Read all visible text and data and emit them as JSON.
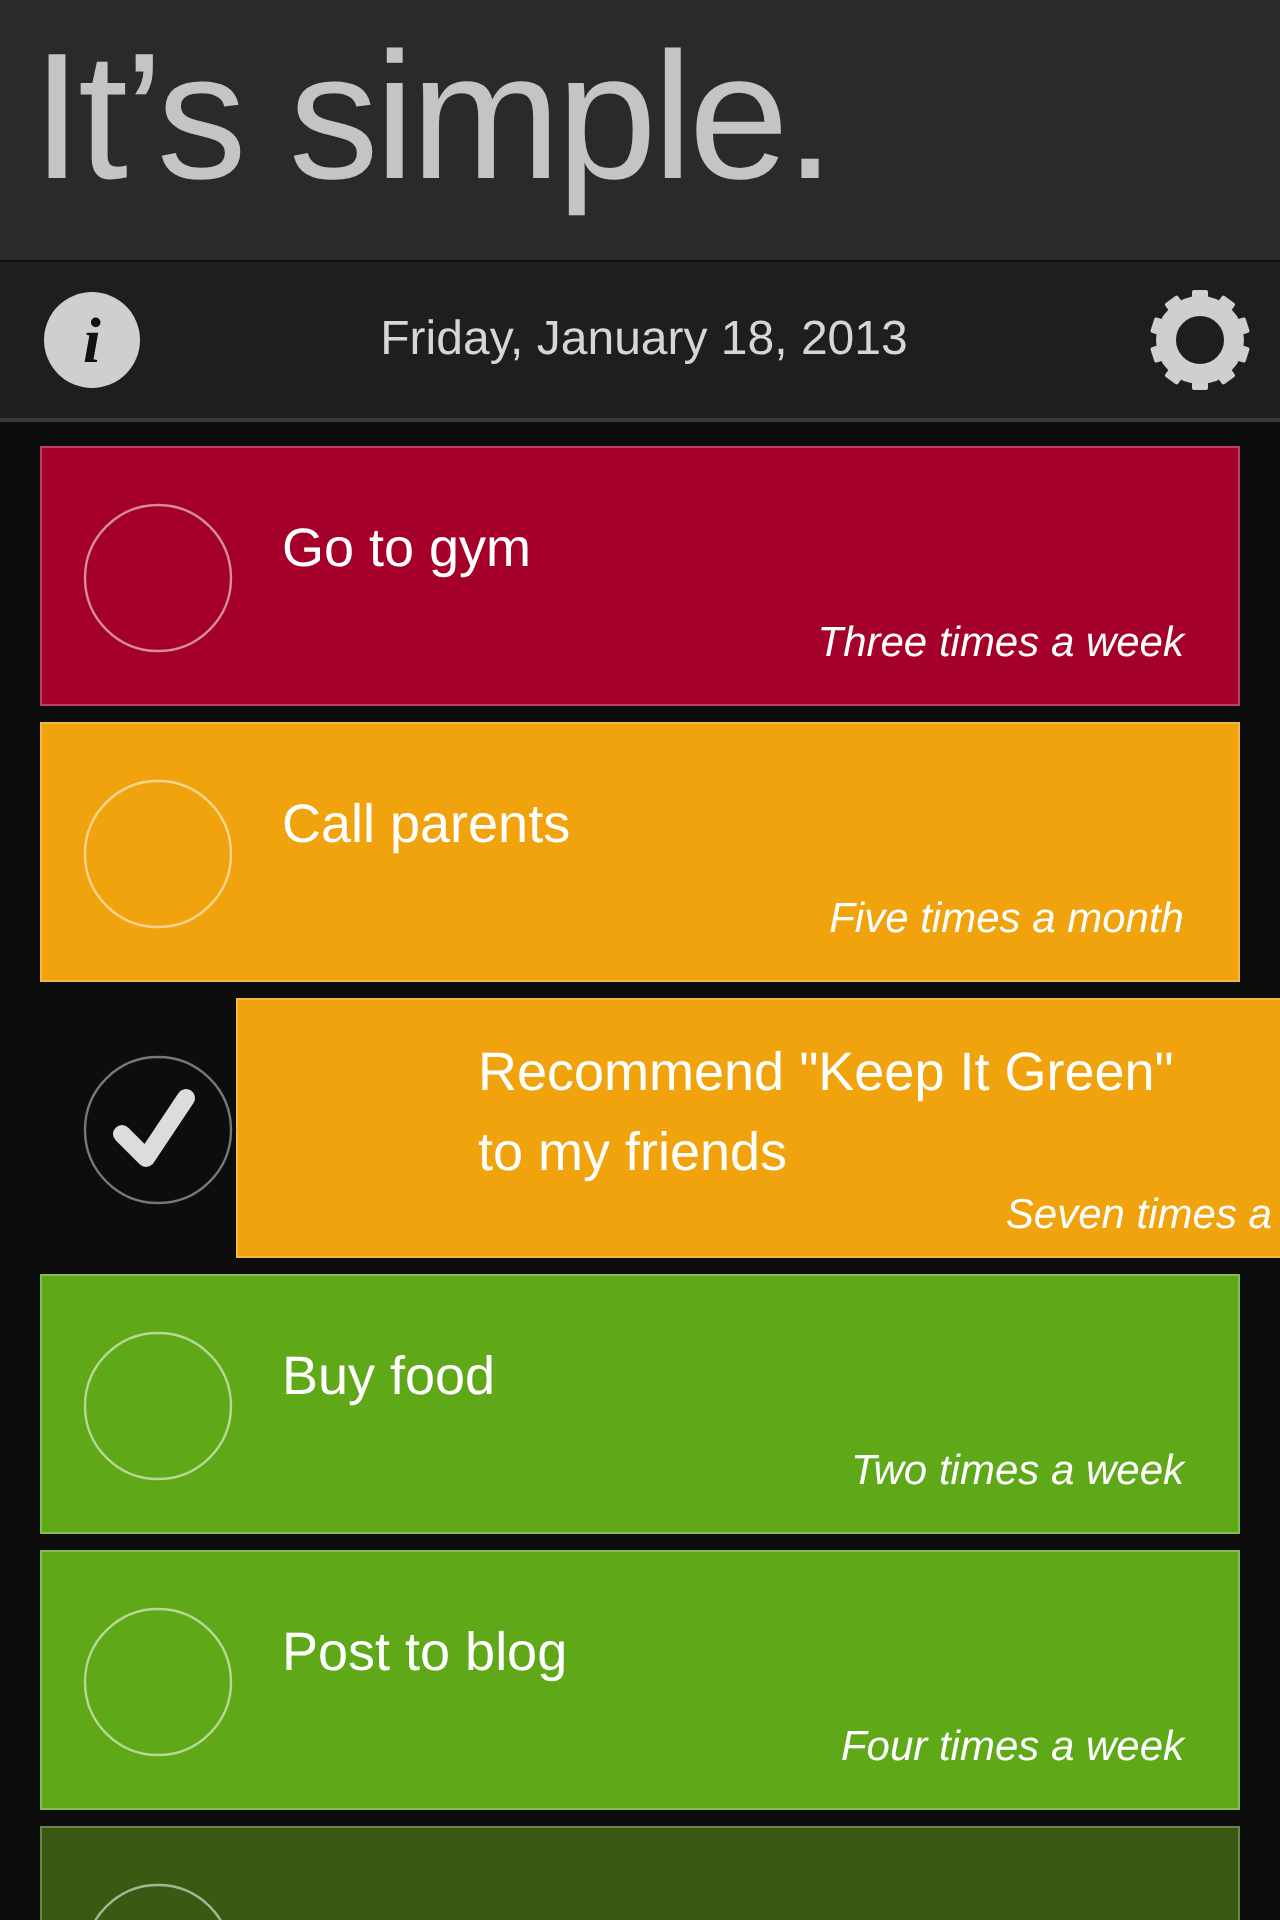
{
  "header": {
    "title": "It’s simple."
  },
  "toolbar": {
    "info_button": "i",
    "date": "Friday, January 18, 2013"
  },
  "tasks": [
    {
      "title": "Go to gym",
      "frequency": "Three times a week",
      "color": "#a50029",
      "checked": false
    },
    {
      "title": "Call parents",
      "frequency": "Five times a month",
      "color": "#f0a30c",
      "checked": false
    },
    {
      "title": "Recommend \"Keep It Green\" to my friends",
      "frequency": "Seven times a",
      "color": "#f0a30c",
      "checked": true
    },
    {
      "title": "Buy food",
      "frequency": "Two times a week",
      "color": "#5fa818",
      "checked": false
    },
    {
      "title": "Post to blog",
      "frequency": "Four times a week",
      "color": "#5fa818",
      "checked": false
    },
    {
      "color": "#3a5a14",
      "checked": false
    }
  ]
}
